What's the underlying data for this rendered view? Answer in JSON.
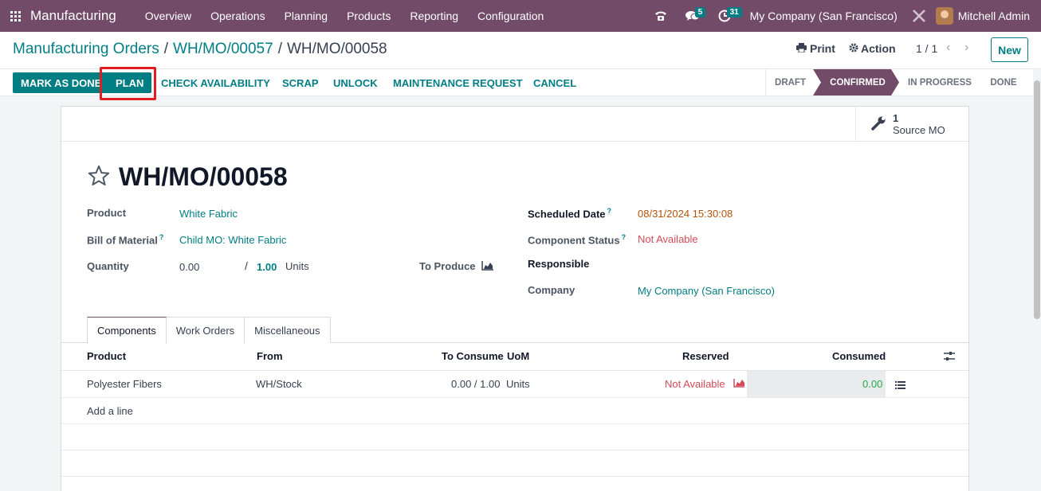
{
  "navbar": {
    "app_name": "Manufacturing",
    "menu": [
      "Overview",
      "Operations",
      "Planning",
      "Products",
      "Reporting",
      "Configuration"
    ],
    "messages_count": "5",
    "activities_count": "31",
    "company": "My Company (San Francisco)",
    "user": "Mitchell Admin"
  },
  "breadcrumb": {
    "items": [
      "Manufacturing Orders",
      "WH/MO/00057"
    ],
    "current": "WH/MO/00058",
    "separator": "/"
  },
  "control": {
    "print_label": "Print",
    "action_label": "Action",
    "pager": "1 / 1",
    "new_label": "New"
  },
  "statusbar": {
    "buttons": [
      "MARK AS DONE",
      "PLAN",
      "CHECK AVAILABILITY",
      "SCRAP",
      "UNLOCK",
      "MAINTENANCE REQUEST",
      "CANCEL"
    ],
    "stages": [
      "DRAFT",
      "CONFIRMED",
      "IN PROGRESS",
      "DONE"
    ],
    "active_stage": "CONFIRMED"
  },
  "smart_button": {
    "value": "1",
    "label": "Source MO"
  },
  "record": {
    "title": "WH/MO/00058",
    "left_fields": {
      "product_label": "Product",
      "product_value": "White Fabric",
      "bom_label": "Bill of Material",
      "bom_value": "Child MO: White Fabric",
      "quantity_label": "Quantity",
      "quantity_produced": "0.00",
      "quantity_sep": "/",
      "quantity_total": "1.00",
      "quantity_uom": "Units",
      "to_produce_label": "To Produce"
    },
    "right_fields": {
      "scheduled_label": "Scheduled Date",
      "scheduled_value": "08/31/2024 15:30:08",
      "component_status_label": "Component Status",
      "component_status_value": "Not Available",
      "responsible_label": "Responsible",
      "company_label": "Company",
      "company_value": "My Company (San Francisco)"
    }
  },
  "tabs": [
    "Components",
    "Work Orders",
    "Miscellaneous"
  ],
  "table": {
    "headers": [
      "Product",
      "From",
      "To Consume",
      "UoM",
      "Reserved",
      "Consumed"
    ],
    "rows": [
      {
        "product": "Polyester Fibers",
        "from": "WH/Stock",
        "to_consume": "0.00 / 1.00",
        "uom": "Units",
        "reserved": "Not Available",
        "consumed": "0.00"
      }
    ],
    "add_line": "Add a line"
  },
  "colors": {
    "brand": "#714b67",
    "accent": "#017e84",
    "danger": "#d44c59",
    "warning_date": "#b45309",
    "consumed_green": "#28a745"
  }
}
